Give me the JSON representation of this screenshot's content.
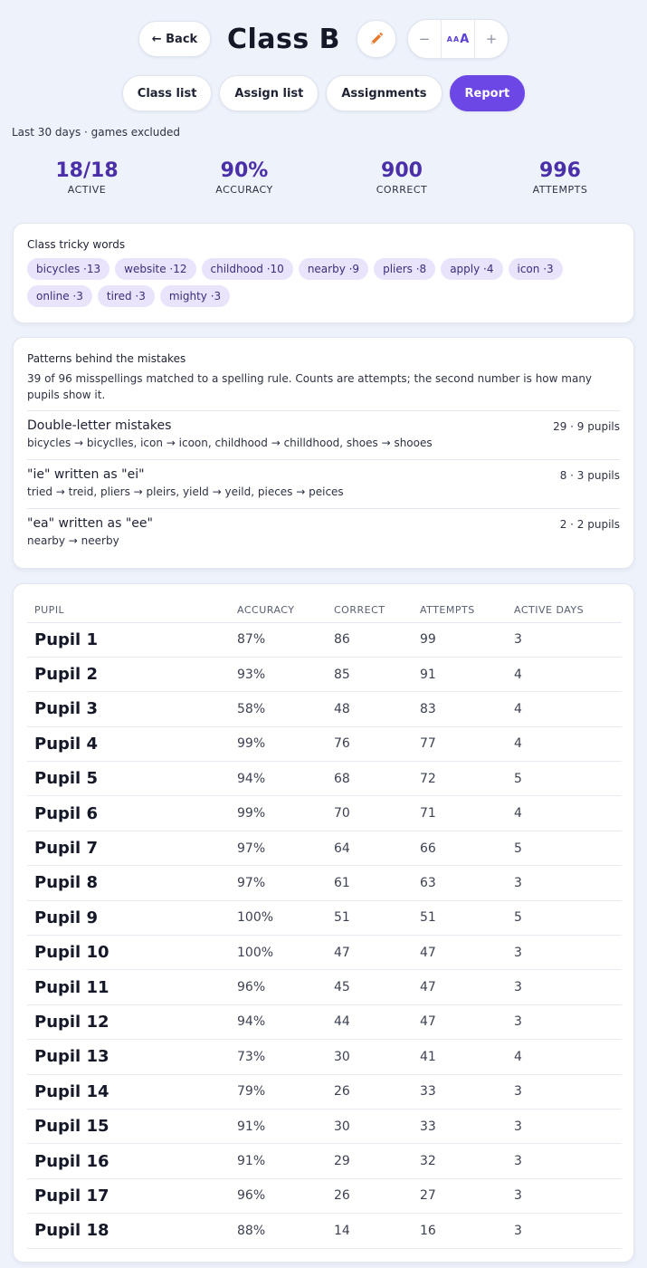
{
  "header": {
    "back_label": "← Back",
    "title": "Class B",
    "edit_icon": "pencil-icon",
    "font_decrease": "−",
    "font_size_small": "A",
    "font_size_large": "A",
    "font_increase": "+"
  },
  "tabs": [
    {
      "label": "Class list",
      "active": false
    },
    {
      "label": "Assign list",
      "active": false
    },
    {
      "label": "Assignments",
      "active": false
    },
    {
      "label": "Report",
      "active": true
    }
  ],
  "range_label": "Last 30 days · games excluded",
  "stats": [
    {
      "value": "18/18",
      "label": "ACTIVE"
    },
    {
      "value": "90%",
      "label": "ACCURACY"
    },
    {
      "value": "900",
      "label": "CORRECT"
    },
    {
      "value": "996",
      "label": "ATTEMPTS"
    }
  ],
  "tricky": {
    "title": "Class tricky words",
    "words": [
      "bicycles ·13",
      "website ·12",
      "childhood ·10",
      "nearby ·9",
      "pliers ·8",
      "apply ·4",
      "icon ·3",
      "online ·3",
      "tired ·3",
      "mighty ·3"
    ]
  },
  "patterns": {
    "title": "Patterns behind the mistakes",
    "description": "39 of 96 misspellings matched to a spelling rule. Counts are attempts; the second number is how many pupils show it.",
    "rows": [
      {
        "name": "Double-letter mistakes",
        "examples": "bicycles → bicyclles, icon → icoon, childhood → chilldhood, shoes → shooes",
        "count": "29 · 9 pupils"
      },
      {
        "name": "\"ie\" written as \"ei\"",
        "examples": "tried → treid, pliers → pleirs, yield → yeild, pieces → peices",
        "count": "8 · 3 pupils"
      },
      {
        "name": "\"ea\" written as \"ee\"",
        "examples": "nearby → neerby",
        "count": "2 · 2 pupils"
      }
    ]
  },
  "table": {
    "headers": [
      "PUPIL",
      "ACCURACY",
      "CORRECT",
      "ATTEMPTS",
      "ACTIVE DAYS"
    ],
    "rows": [
      [
        "Pupil 1",
        "87%",
        "86",
        "99",
        "3"
      ],
      [
        "Pupil 2",
        "93%",
        "85",
        "91",
        "4"
      ],
      [
        "Pupil 3",
        "58%",
        "48",
        "83",
        "4"
      ],
      [
        "Pupil 4",
        "99%",
        "76",
        "77",
        "4"
      ],
      [
        "Pupil 5",
        "94%",
        "68",
        "72",
        "5"
      ],
      [
        "Pupil 6",
        "99%",
        "70",
        "71",
        "4"
      ],
      [
        "Pupil 7",
        "97%",
        "64",
        "66",
        "5"
      ],
      [
        "Pupil 8",
        "97%",
        "61",
        "63",
        "3"
      ],
      [
        "Pupil 9",
        "100%",
        "51",
        "51",
        "5"
      ],
      [
        "Pupil 10",
        "100%",
        "47",
        "47",
        "3"
      ],
      [
        "Pupil 11",
        "96%",
        "45",
        "47",
        "3"
      ],
      [
        "Pupil 12",
        "94%",
        "44",
        "47",
        "3"
      ],
      [
        "Pupil 13",
        "73%",
        "30",
        "41",
        "4"
      ],
      [
        "Pupil 14",
        "79%",
        "26",
        "33",
        "3"
      ],
      [
        "Pupil 15",
        "91%",
        "30",
        "33",
        "3"
      ],
      [
        "Pupil 16",
        "91%",
        "29",
        "32",
        "3"
      ],
      [
        "Pupil 17",
        "96%",
        "26",
        "27",
        "3"
      ],
      [
        "Pupil 18",
        "88%",
        "14",
        "16",
        "3"
      ]
    ]
  },
  "colors": {
    "accent": "#6c47e6",
    "stat_text": "#4a2fa8",
    "chip_bg": "#e9e3fb",
    "background": "#eef2fb",
    "pencil": "#e87a2e"
  }
}
